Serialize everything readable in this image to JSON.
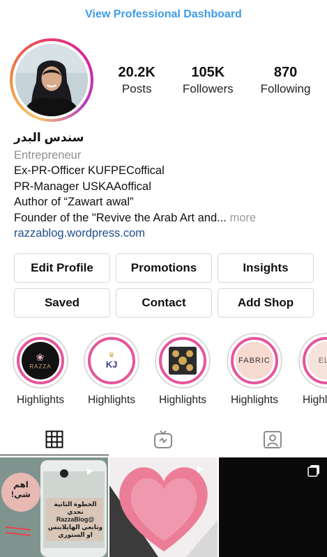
{
  "header": {
    "dashboard_link": "View Professional Dashboard"
  },
  "profile": {
    "stats": [
      {
        "value": "20.2K",
        "label": "Posts"
      },
      {
        "value": "105K",
        "label": "Followers"
      },
      {
        "value": "870",
        "label": "Following"
      }
    ],
    "name": "سندس البدر",
    "category": "Entrepreneur",
    "bio_lines": [
      "Ex-PR-Officer KUFPECoffical",
      "PR-Manager USKAAoffical",
      "Author of “Zawart awal”",
      "Founder of the \"Revive the Arab Art and..."
    ],
    "more_label": "more",
    "website": "razzablog.wordpress.com"
  },
  "buttons": {
    "edit_profile": "Edit Profile",
    "promotions": "Promotions",
    "insights": "Insights",
    "saved": "Saved",
    "contact": "Contact",
    "add_shop": "Add Shop"
  },
  "highlights": [
    {
      "label": "Highlights",
      "cover_text": "RAZZA"
    },
    {
      "label": "Highlights",
      "cover_text": "KJ"
    },
    {
      "label": "Highlights",
      "cover_text": ""
    },
    {
      "label": "Highlights",
      "cover_text": "FABRIC"
    },
    {
      "label": "Highlights",
      "cover_text": "ELL"
    }
  ],
  "tabs": [
    {
      "icon": "grid-icon"
    },
    {
      "icon": "igtv-icon"
    },
    {
      "icon": "tagged-person-icon"
    }
  ],
  "posts": [
    {
      "text_lines": [
        "اهم شي!",
        "الخطوة الثانية",
        "تحدي",
        "@RazzaBlog",
        "وتابعي الهايلايتس",
        "او الستوري"
      ]
    },
    {
      "text_lines": []
    },
    {
      "text_lines": []
    }
  ],
  "colors": {
    "link_blue": "#3f9be6",
    "highlight_ring": "#e4559c",
    "website_blue": "#1f4f8a"
  }
}
